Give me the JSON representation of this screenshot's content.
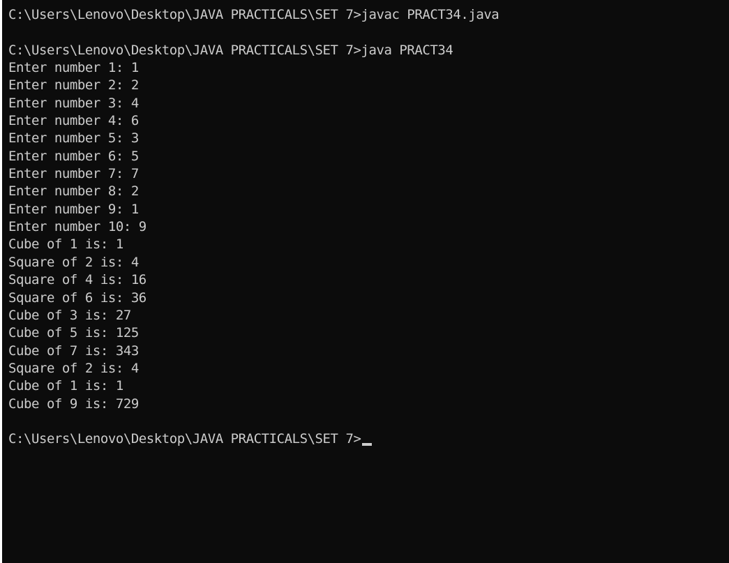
{
  "console": {
    "lines": [
      "C:\\Users\\Lenovo\\Desktop\\JAVA PRACTICALS\\SET 7>javac PRACT34.java",
      "",
      "C:\\Users\\Lenovo\\Desktop\\JAVA PRACTICALS\\SET 7>java PRACT34",
      "Enter number 1: 1",
      "Enter number 2: 2",
      "Enter number 3: 4",
      "Enter number 4: 6",
      "Enter number 5: 3",
      "Enter number 6: 5",
      "Enter number 7: 7",
      "Enter number 8: 2",
      "Enter number 9: 1",
      "Enter number 10: 9",
      "Cube of 1 is: 1",
      "Square of 2 is: 4",
      "Square of 4 is: 16",
      "Square of 6 is: 36",
      "Cube of 3 is: 27",
      "Cube of 5 is: 125",
      "Cube of 7 is: 343",
      "Square of 2 is: 4",
      "Cube of 1 is: 1",
      "Cube of 9 is: 729",
      "",
      "C:\\Users\\Lenovo\\Desktop\\JAVA PRACTICALS\\SET 7>"
    ]
  },
  "colors": {
    "background": "#0c0c0c",
    "text": "#cccccc"
  }
}
